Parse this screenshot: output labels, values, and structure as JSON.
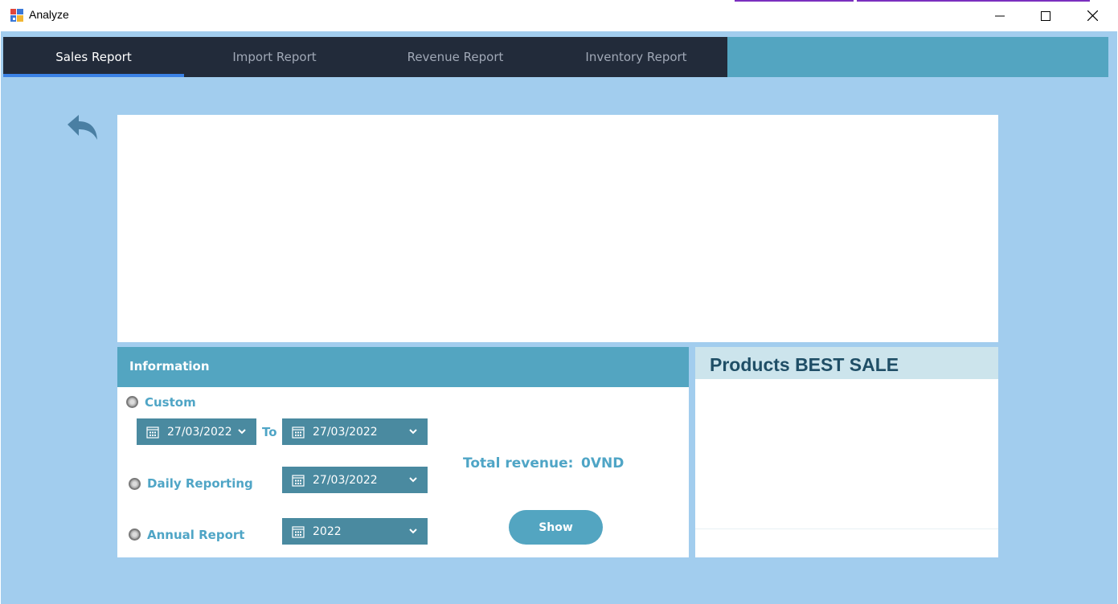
{
  "window": {
    "title": "Analyze",
    "controls": {
      "minimize": "minimize-icon",
      "maximize": "maximize-icon",
      "close": "close-icon"
    }
  },
  "tabs": [
    {
      "label": "Sales Report",
      "active": true
    },
    {
      "label": "Import Report",
      "active": false
    },
    {
      "label": "Revenue Report",
      "active": false
    },
    {
      "label": "Inventory Report",
      "active": false
    }
  ],
  "back": {
    "icon": "reply-arrow-icon"
  },
  "info": {
    "title": "Information",
    "custom": {
      "label": "Custom",
      "from_date": "27/03/2022",
      "to_label": "To",
      "to_date": "27/03/2022"
    },
    "daily": {
      "label": "Daily Reporting",
      "date": "27/03/2022"
    },
    "annual": {
      "label": "Annual Report",
      "year": "2022"
    },
    "revenue_label": "Total revenue:",
    "revenue_value": "0VND",
    "show_label": "Show"
  },
  "best_sale": {
    "title": "Products BEST SALE"
  },
  "colors": {
    "background": "#a2cdee",
    "tab_bar": "#222b3a",
    "tab_active_underline": "#3b82e6",
    "accent": "#53a5c1",
    "picker": "#4a8aa0",
    "label_text": "#4fa5c6",
    "best_title": "#1f4e66"
  }
}
